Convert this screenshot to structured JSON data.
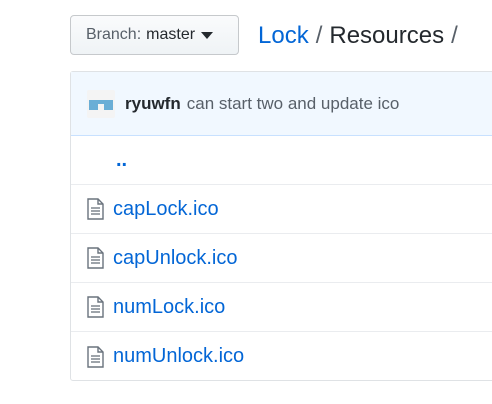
{
  "branch": {
    "prefix": "Branch:",
    "name": "master"
  },
  "breadcrumb": {
    "repo": "Lock",
    "separator": "/",
    "folder": "Resources",
    "trailing_separator": "/"
  },
  "commit": {
    "author": "ryuwfn",
    "message": "can start two and update ico"
  },
  "parent_link": "..",
  "files": [
    {
      "name": "capLock.ico",
      "icon": "file-icon"
    },
    {
      "name": "capUnlock.ico",
      "icon": "file-icon"
    },
    {
      "name": "numLock.ico",
      "icon": "file-icon"
    },
    {
      "name": "numUnlock.ico",
      "icon": "file-icon"
    }
  ],
  "colors": {
    "link": "#0366d6",
    "commit_bar": "#f1f8ff",
    "text": "#24292e",
    "muted": "#586069"
  }
}
